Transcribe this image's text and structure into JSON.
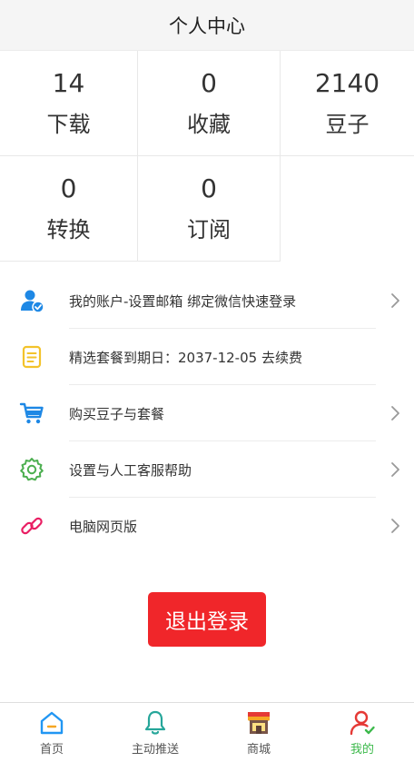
{
  "header": {
    "title": "个人中心"
  },
  "stats": [
    {
      "value": "14",
      "label": "下载"
    },
    {
      "value": "0",
      "label": "收藏"
    },
    {
      "value": "2140",
      "label": "豆子"
    },
    {
      "value": "0",
      "label": "转换"
    },
    {
      "value": "0",
      "label": "订阅"
    }
  ],
  "menu": [
    {
      "label": "我的账户-设置邮箱 绑定微信快速登录",
      "icon": "user-check-icon"
    },
    {
      "label": "精选套餐到期日：2037-12-05 去续费",
      "icon": "document-icon"
    },
    {
      "label": "购买豆子与套餐",
      "icon": "cart-icon"
    },
    {
      "label": "设置与人工客服帮助",
      "icon": "gear-icon"
    },
    {
      "label": "电脑网页版",
      "icon": "link-icon"
    }
  ],
  "logout": {
    "label": "退出登录"
  },
  "tabbar": [
    {
      "label": "首页",
      "icon": "home-icon"
    },
    {
      "label": "主动推送",
      "icon": "bell-icon"
    },
    {
      "label": "商城",
      "icon": "shop-icon"
    },
    {
      "label": "我的",
      "icon": "profile-icon"
    }
  ],
  "colors": {
    "logout": "#f0262a",
    "active_tab": "#3cb94b",
    "icon_blue": "#1e88e5"
  }
}
